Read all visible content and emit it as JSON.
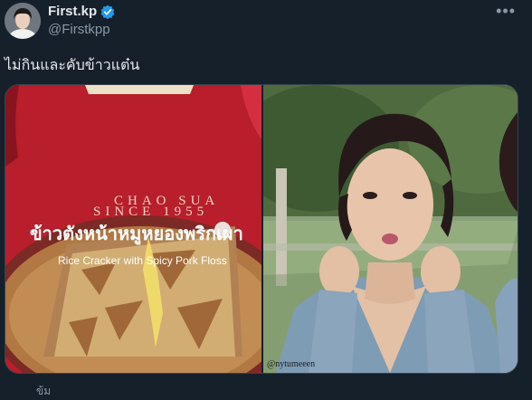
{
  "author": {
    "display_name": "First.kp",
    "handle": "@Firstkpp",
    "verified": true,
    "avatar_icon": "profile-avatar"
  },
  "tweet": {
    "text": "ไม่กินและคับข้าวแต๋น",
    "more_icon": "more-horizontal-icon"
  },
  "media": {
    "left_photo": {
      "brand_line1": "CHAO SUA",
      "brand_line2": "SINCE 1955",
      "product_thai": "ข้าวตังหน้าหมูหยองพริกเผา",
      "product_english": "Rice Cracker with Spicy Pork Floss"
    },
    "right_photo": {
      "watermark": "@nytumeeen"
    }
  },
  "footer": {
    "partial_text": "ข้ม"
  },
  "colors": {
    "background": "#15202b",
    "verified_blue": "#1d9bf0",
    "package_red": "#b81e2c",
    "secondary_text": "#8b98a5"
  }
}
